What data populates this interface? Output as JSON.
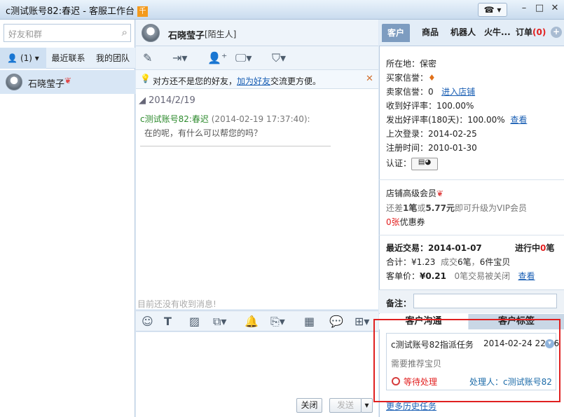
{
  "window": {
    "title": "c测试账号82:春迟 - 客服工作台",
    "badge": "千",
    "phone_icon": "phone-icon"
  },
  "left": {
    "search_placeholder": "好友和群",
    "tabs": [
      "(1)",
      "最近联系",
      "我的团队"
    ],
    "contacts": [
      {
        "name": "石晓莹子"
      }
    ]
  },
  "chat": {
    "name": "石晓莹子",
    "tag": "[陌生人]",
    "notice_pre": "对方还不是您的好友，",
    "notice_link": "加为好友",
    "notice_post": "交流更方便。",
    "date": "2014/2/19",
    "sender": "c测试账号82:春迟",
    "time": "(2014-02-19 17:37:40):",
    "message": "在的呢，有什么可以帮您的吗？",
    "empty_hint": "目前还没有收到消息!",
    "close_btn": "关闭",
    "send_btn": "发送"
  },
  "right": {
    "tabs": [
      "客户",
      "商品",
      "机器人",
      "火牛...",
      "订单(0)"
    ],
    "location_label": "所在地：",
    "location_value": "保密",
    "buyer_credit": "买家信誉：",
    "seller_credit_label": "卖家信誉：",
    "seller_credit_value": "0",
    "enter_shop": "进入店铺",
    "received_rate": "收到好评率：100.00%",
    "sent_rate_label": "发出好评率(180天)：100.00%",
    "sent_rate_link": "查看",
    "last_login": "上次登录：2014-02-25",
    "register": "注册时间：2010-01-30",
    "auth": "认证：",
    "vip_title": "店铺高级会员",
    "vip_pre": "还差",
    "vip_n1": "1笔",
    "vip_mid": "或",
    "vip_n2": "5.77元",
    "vip_post": "即可升级为VIP会员",
    "coupon_num": "0张",
    "coupon_text": "优惠券",
    "recent_label": "最近交易：",
    "recent_date": "2014-01-07",
    "ongoing_pre": "进行中",
    "ongoing_num": "0",
    "ongoing_post": "笔",
    "total_label": "合计：",
    "total_value": "¥1.23",
    "total_desc_pre": "成交",
    "total_n1": "6笔",
    "total_desc_mid": "，",
    "total_n2": "6件宝贝",
    "avg_label": "客单价：",
    "avg_value": "¥0.21",
    "avg_desc": "0笔交易被关闭",
    "avg_link": "查看",
    "note_label": "备注：",
    "comm_tabs": [
      "客户沟通",
      "客户标签"
    ],
    "task_title": "c测试账号82指派任务",
    "task_time": "2014-02-24 22:46",
    "task_desc": "需要推荐宝贝",
    "task_status": "等待处理",
    "task_handler": "处理人：c测试账号82",
    "history_link": "更多历史任务"
  }
}
